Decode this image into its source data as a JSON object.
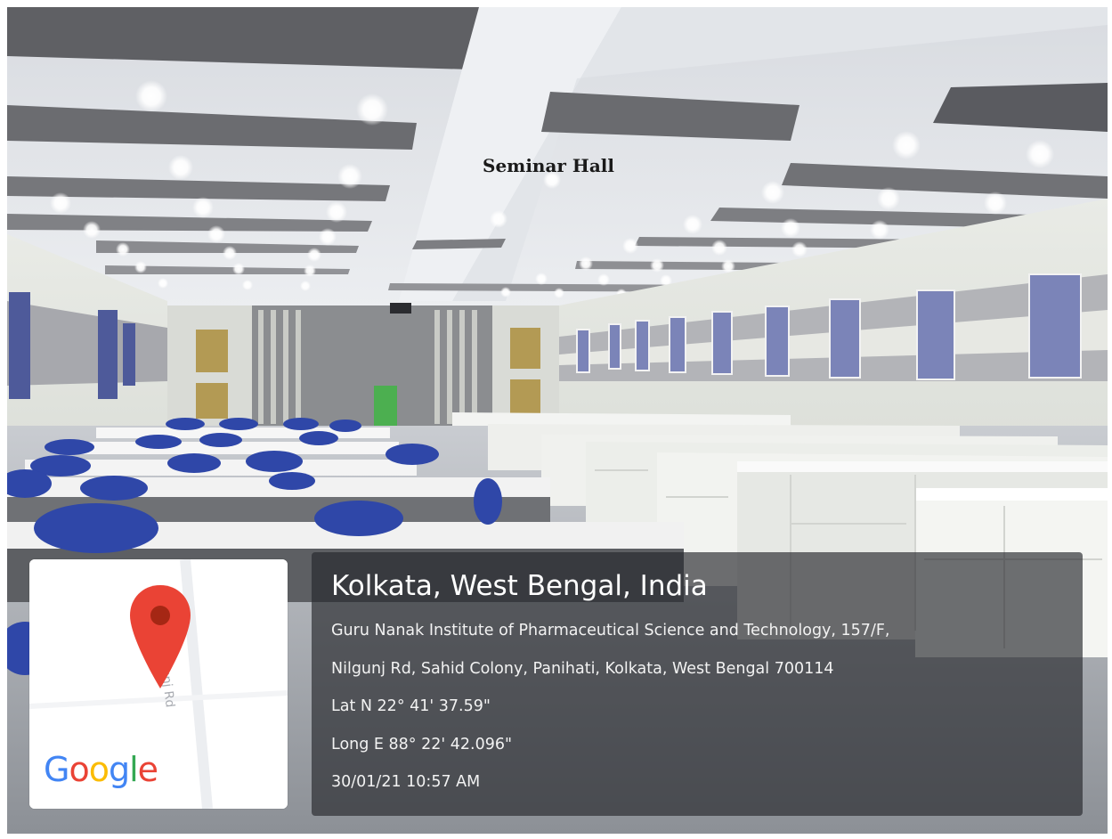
{
  "caption": "Seminar Hall",
  "map": {
    "road_label": "Nilgunj Rd",
    "logo_letters": [
      "G",
      "o",
      "o",
      "g",
      "l",
      "e"
    ],
    "logo_colors": [
      "#4285F4",
      "#EA4335",
      "#FBBC05",
      "#4285F4",
      "#34A853",
      "#EA4335"
    ],
    "pin_color": "#EA4335"
  },
  "location": {
    "title": "Kolkata, West Bengal, India",
    "address_line_1": "Guru Nanak Institute of Pharmaceutical Science and Technology, 157/F,",
    "address_line_2": "Nilgunj Rd, Sahid Colony, Panihati, Kolkata, West Bengal 700114",
    "latitude": "Lat N 22° 41' 37.59\"",
    "longitude": "Long E 88° 22' 42.096\"",
    "timestamp": "30/01/21 10:57 AM"
  }
}
